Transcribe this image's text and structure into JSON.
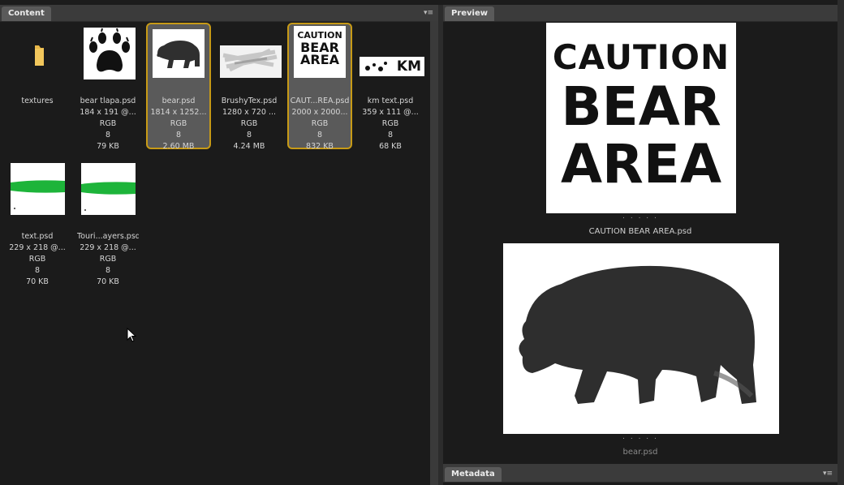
{
  "content": {
    "tab_label": "Content",
    "menu_icon": "panel-menu-icon",
    "items": [
      {
        "name": "textures",
        "thumb": "folder-icon",
        "size": "",
        "mode": "",
        "bits": "",
        "filesize": ""
      },
      {
        "name": "bear tlapa.psd",
        "thumb": "paw-print",
        "size": "184 x 191 @...",
        "mode": "RGB",
        "bits": "8",
        "filesize": "79 KB"
      },
      {
        "name": "bear.psd",
        "thumb": "bear-silhouette",
        "size": "1814 x 1252...",
        "mode": "RGB",
        "bits": "8",
        "filesize": "2.60 MB",
        "selected": true
      },
      {
        "name": "BrushyTex.psd",
        "thumb": "brushy-texture",
        "size": "1280 x 720 ...",
        "mode": "RGB",
        "bits": "8",
        "filesize": "4.24 MB"
      },
      {
        "name": "CAUT...REA.psd",
        "thumb": "caution-sign",
        "size": "2000 x 2000...",
        "mode": "RGB",
        "bits": "8",
        "filesize": "832 KB",
        "selected": true
      },
      {
        "name": "km text.psd",
        "thumb": "km-text",
        "size": "359 x 111 @...",
        "mode": "RGB",
        "bits": "8",
        "filesize": "68 KB"
      },
      {
        "name": "text.psd",
        "thumb": "green-stroke",
        "size": "229 x 218 @...",
        "mode": "RGB",
        "bits": "8",
        "filesize": "70 KB"
      },
      {
        "name": "Touri...ayers.psd",
        "thumb": "green-stroke",
        "size": "229 x 218 @...",
        "mode": "RGB",
        "bits": "8",
        "filesize": "70 KB"
      }
    ],
    "thumb_texts": {
      "caution_line1": "CAUTION",
      "caution_line2": "BEAR",
      "caution_line3": "AREA",
      "km_text": "KM"
    }
  },
  "preview": {
    "tab_label": "Preview",
    "images": [
      {
        "caption": "CAUTION BEAR AREA.psd",
        "lines": [
          "CAUTION",
          "BEAR",
          "AREA"
        ]
      },
      {
        "caption": "bear.psd"
      }
    ],
    "dots": ". . . . ."
  },
  "metadata": {
    "tab_label": "Metadata"
  },
  "colors": {
    "selection_border": "#c79a16",
    "folder": "#e8b84a",
    "red_bar": "#e03a3a",
    "green_stroke": "#1db43a"
  }
}
